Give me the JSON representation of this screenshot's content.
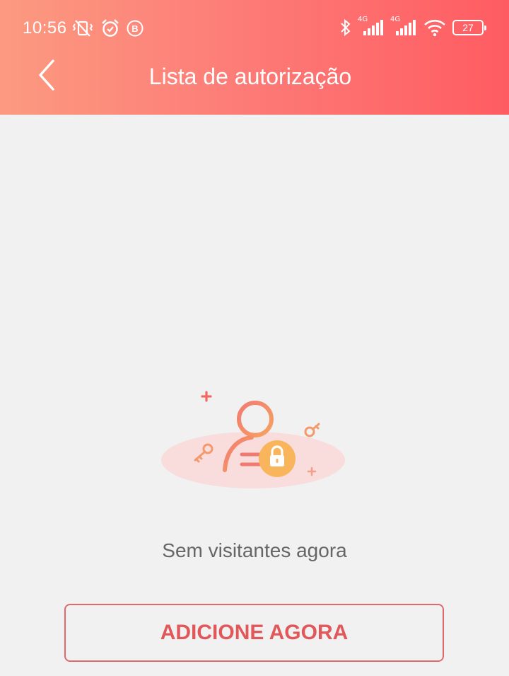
{
  "status_bar": {
    "time": "10:56",
    "network_1": "4G",
    "network_2": "4G",
    "battery_level": "27",
    "left_icons": [
      "vibrate-off-icon",
      "alarm-icon",
      "b-badge-icon"
    ],
    "right_icons": [
      "bluetooth-icon",
      "signal-icon",
      "signal-icon",
      "wifi-icon",
      "battery-icon"
    ]
  },
  "header": {
    "title": "Lista de autorização",
    "back_icon": "chevron-left-icon",
    "gradient_start": "#fc9a80",
    "gradient_end": "#fe5c62"
  },
  "empty_state": {
    "illustration_icon": "user-lock-icon",
    "message": "Sem visitantes agora"
  },
  "actions": {
    "add_label": "ADICIONE AGORA",
    "accent_color": "#e0585a"
  }
}
